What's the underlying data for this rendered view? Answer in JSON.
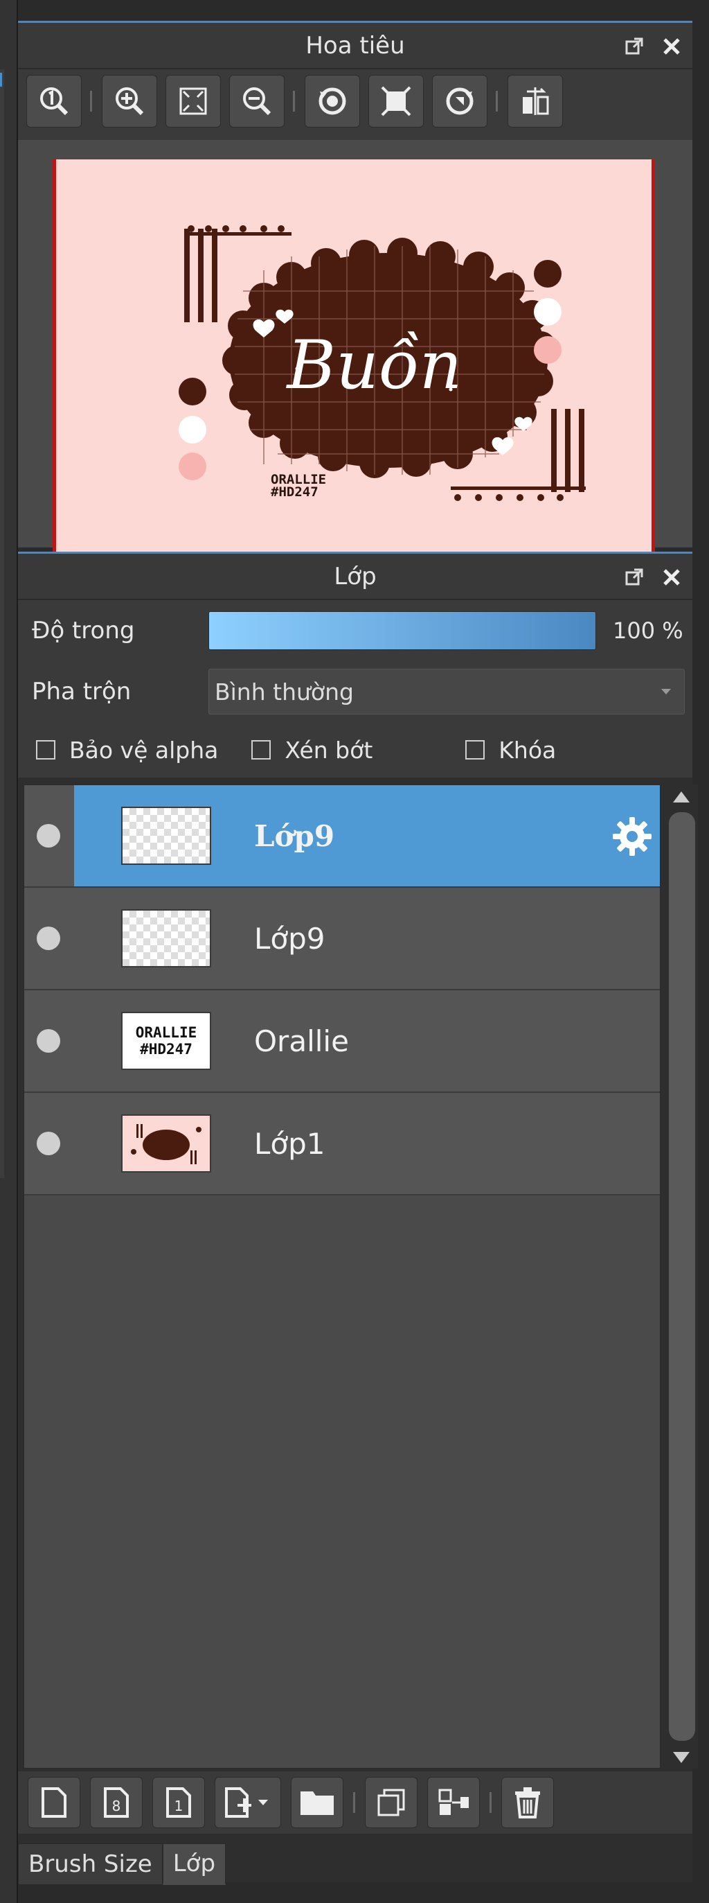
{
  "navigator": {
    "title": "Hoa tiêu",
    "preview": {
      "lettering": "Buồn",
      "watermark_line1": "ORALLIE",
      "watermark_line2": "#HD247"
    }
  },
  "layers_panel": {
    "title": "Lớp",
    "opacity_label": "Độ trong",
    "opacity_value": "100 %",
    "opacity_level": 1.0,
    "blend_label": "Pha trộn",
    "blend_value": "Bình thường",
    "checks": [
      {
        "label": "Bảo vệ alpha"
      },
      {
        "label": "Xén bớt"
      },
      {
        "label": "Khóa"
      }
    ],
    "layers": [
      {
        "name": "Lớp9",
        "selected": true
      },
      {
        "name": "Lớp9",
        "selected": false
      },
      {
        "name": "Orallie",
        "selected": false,
        "thumb_text1": "ORALLIE",
        "thumb_text2": "#HD247"
      },
      {
        "name": "Lớp1",
        "selected": false
      }
    ]
  },
  "tabs": [
    {
      "label": "Brush Size"
    },
    {
      "label": "Lớp"
    }
  ],
  "colors": {
    "accent": "#4f9ad4",
    "canvas_bg": "#fdd9d6",
    "brown": "#4a1c10"
  }
}
